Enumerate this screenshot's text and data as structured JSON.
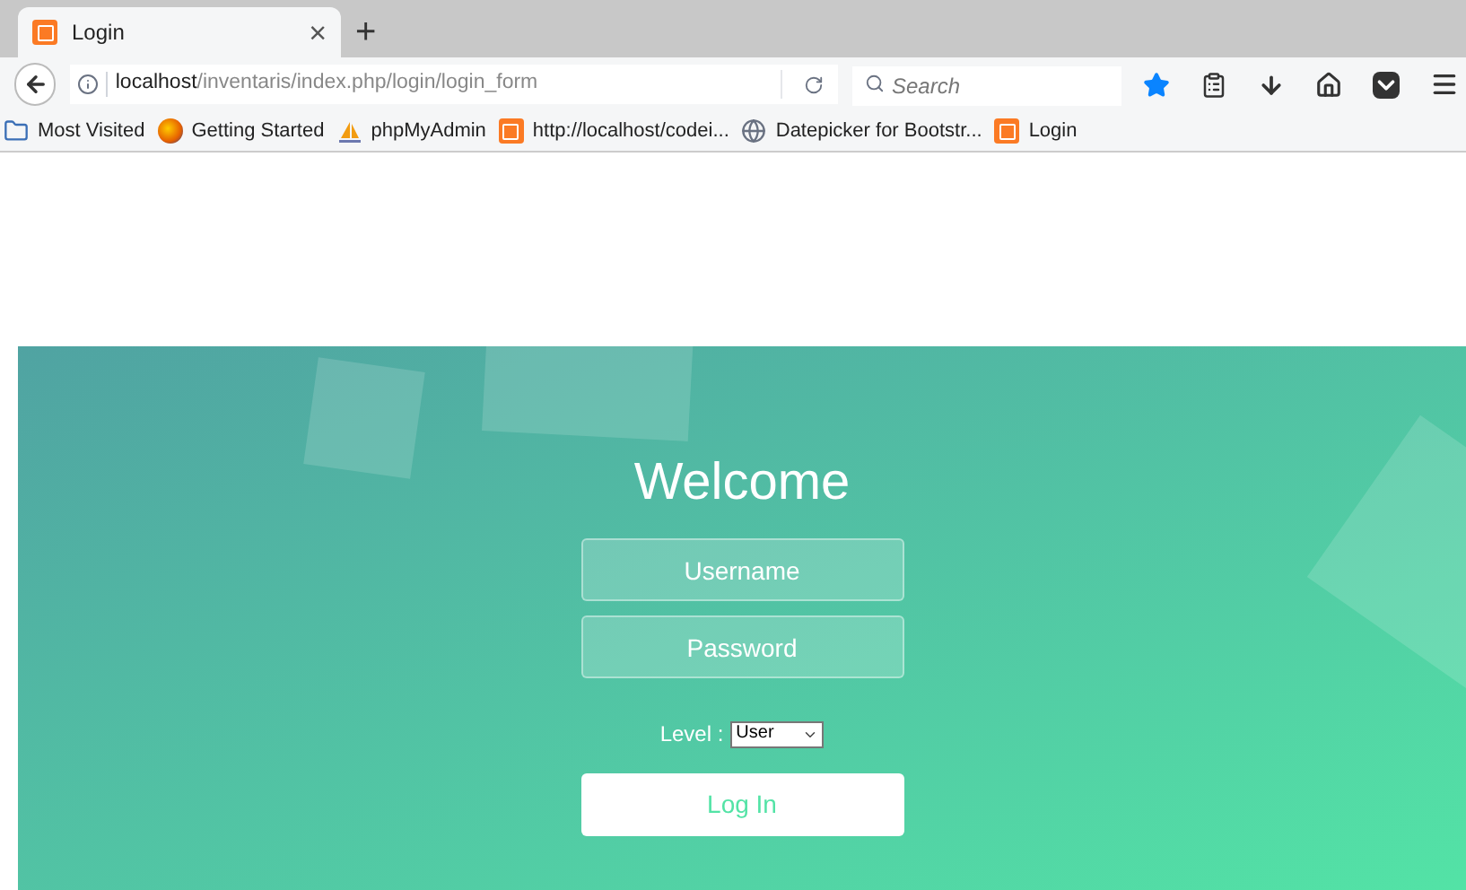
{
  "tabs": [
    {
      "title": "Login",
      "close": "×",
      "selected": true
    }
  ],
  "new_tab": "+",
  "address_bar": {
    "host": "localhost",
    "path": "/inventaris/index.php/login/login_form"
  },
  "search": {
    "placeholder": "Search"
  },
  "bookmarked": true,
  "bookmarks": [
    {
      "label": "Most Visited",
      "kind": "folder"
    },
    {
      "label": "Getting Started",
      "kind": "firefox"
    },
    {
      "label": "phpMyAdmin",
      "kind": "pma"
    },
    {
      "label": "http://localhost/codei...",
      "kind": "xampp"
    },
    {
      "label": "Datepicker for Bootstr...",
      "kind": "globe"
    },
    {
      "label": "Login",
      "kind": "xampp"
    }
  ],
  "login": {
    "title": "Welcome",
    "username": {
      "placeholder": "Username"
    },
    "password": {
      "placeholder": "Password"
    },
    "level_label": "Level :",
    "level_value": "User",
    "button": "Log In"
  }
}
